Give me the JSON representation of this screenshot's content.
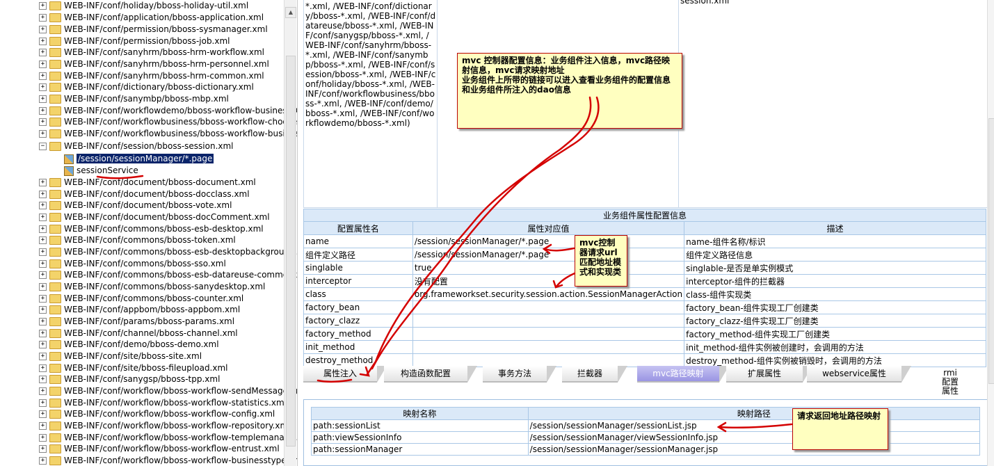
{
  "tree": {
    "items": [
      {
        "label": "WEB-INF/conf/holiday/bboss-holiday-util.xml",
        "type": "folder"
      },
      {
        "label": "WEB-INF/conf/application/bboss-application.xml",
        "type": "folder"
      },
      {
        "label": "WEB-INF/conf/permission/bboss-sysmanager.xml",
        "type": "folder"
      },
      {
        "label": "WEB-INF/conf/permission/bboss-job.xml",
        "type": "folder"
      },
      {
        "label": "WEB-INF/conf/sanyhrm/bboss-hrm-workflow.xml",
        "type": "folder"
      },
      {
        "label": "WEB-INF/conf/sanyhrm/bboss-hrm-personnel.xml",
        "type": "folder"
      },
      {
        "label": "WEB-INF/conf/sanyhrm/bboss-hrm-common.xml",
        "type": "folder"
      },
      {
        "label": "WEB-INF/conf/dictionary/bboss-dictionary.xml",
        "type": "folder"
      },
      {
        "label": "WEB-INF/conf/sanymbp/bboss-mbp.xml",
        "type": "folder"
      },
      {
        "label": "WEB-INF/conf/workflowdemo/bboss-workflow-businessDe",
        "type": "folder"
      },
      {
        "label": "WEB-INF/conf/workflowbusiness/bboss-workflow-chooseU",
        "type": "folder"
      },
      {
        "label": "WEB-INF/conf/workflowbusiness/bboss-workflow-business",
        "type": "folder"
      },
      {
        "label": "WEB-INF/conf/session/bboss-session.xml",
        "type": "folder-open"
      },
      {
        "label": "/session/sessionManager/*.page",
        "type": "leaf-selected"
      },
      {
        "label": "sessionService",
        "type": "leaf"
      },
      {
        "label": "WEB-INF/conf/document/bboss-document.xml",
        "type": "folder"
      },
      {
        "label": "WEB-INF/conf/document/bboss-docclass.xml",
        "type": "folder"
      },
      {
        "label": "WEB-INF/conf/document/bboss-vote.xml",
        "type": "folder"
      },
      {
        "label": "WEB-INF/conf/document/bboss-docComment.xml",
        "type": "folder"
      },
      {
        "label": "WEB-INF/conf/commons/bboss-esb-desktop.xml",
        "type": "folder"
      },
      {
        "label": "WEB-INF/conf/commons/bboss-token.xml",
        "type": "folder"
      },
      {
        "label": "WEB-INF/conf/commons/bboss-esb-desktopbackground.x",
        "type": "folder"
      },
      {
        "label": "WEB-INF/conf/commons/bboss-sso.xml",
        "type": "folder"
      },
      {
        "label": "WEB-INF/conf/commons/bboss-esb-datareuse-common.xr",
        "type": "folder"
      },
      {
        "label": "WEB-INF/conf/commons/bboss-sanydesktop.xml",
        "type": "folder"
      },
      {
        "label": "WEB-INF/conf/commons/bboss-counter.xml",
        "type": "folder"
      },
      {
        "label": "WEB-INF/conf/appbom/bboss-appbom.xml",
        "type": "folder"
      },
      {
        "label": "WEB-INF/conf/params/bboss-params.xml",
        "type": "folder"
      },
      {
        "label": "WEB-INF/conf/channel/bboss-channel.xml",
        "type": "folder"
      },
      {
        "label": "WEB-INF/conf/demo/bboss-demo.xml",
        "type": "folder"
      },
      {
        "label": "WEB-INF/conf/site/bboss-site.xml",
        "type": "folder"
      },
      {
        "label": "WEB-INF/conf/site/bboss-fileupload.xml",
        "type": "folder"
      },
      {
        "label": "WEB-INF/conf/sanygsp/bboss-tpp.xml",
        "type": "folder"
      },
      {
        "label": "WEB-INF/conf/workflow/bboss-workflow-sendMessage.xm",
        "type": "folder"
      },
      {
        "label": "WEB-INF/conf/workflow/bboss-workflow-statistics.xml",
        "type": "folder"
      },
      {
        "label": "WEB-INF/conf/workflow/bboss-workflow-config.xml",
        "type": "folder"
      },
      {
        "label": "WEB-INF/conf/workflow/bboss-workflow-repository.xml",
        "type": "folder"
      },
      {
        "label": "WEB-INF/conf/workflow/bboss-workflow-templemanage.x",
        "type": "folder"
      },
      {
        "label": "WEB-INF/conf/workflow/bboss-workflow-entrust.xml",
        "type": "folder"
      },
      {
        "label": "WEB-INF/conf/workflow/bboss-workflow-businesstype.xm",
        "type": "folder"
      }
    ]
  },
  "top_cells": {
    "paths_text": "*.xml, /WEB-INF/conf/dictionary/bboss-*.xml, /WEB-INF/conf/datareuse/bboss-*.xml, /WEB-INF/conf/sanygsp/bboss-*.xml, /WEB-INF/conf/sanyhrm/bboss-*.xml, /WEB-INF/conf/sanymbp/bboss-*.xml, /WEB-INF/conf/session/bboss-*.xml, /WEB-INF/conf/holiday/bboss-*.xml, /WEB-INF/conf/workflowbusiness/bboss-*.xml, /WEB-INF/conf/demo/bboss-*.xml, /WEB-INF/conf/workflowdemo/bboss-*.xml)",
    "right_text": "session.xml"
  },
  "props_table": {
    "caption": "业务组件属性配置信息",
    "headers": [
      "配置属性名",
      "属性对应值",
      "描述"
    ],
    "rows": [
      [
        "name",
        "/session/sessionManager/*.page",
        "name-组件名称/标识"
      ],
      [
        "组件定义路径",
        "/session/sessionManager/*.page",
        "组件定义路径信息"
      ],
      [
        "singlable",
        "true",
        "singlable-是否是单实例模式"
      ],
      [
        "interceptor",
        "没有配置",
        "interceptor-组件的拦截器"
      ],
      [
        "class",
        "org.frameworkset.security.session.action.SessionManagerAction",
        "class-组件实现类"
      ],
      [
        "factory_bean",
        "",
        "factory_bean-组件实现工厂创建类"
      ],
      [
        "factory_clazz",
        "",
        "factory_clazz-组件实现工厂创建类"
      ],
      [
        "factory_method",
        "",
        "factory_method-组件实现工厂创建类"
      ],
      [
        "init_method",
        "",
        "init_method-组件实例被创建时，会调用的方法"
      ],
      [
        "destroy_method",
        "",
        "destroy_method-组件实例被销毁时，会调用的方法"
      ]
    ]
  },
  "tabs": [
    {
      "label": "属性注入",
      "active": false
    },
    {
      "label": "构造函数配置",
      "active": false
    },
    {
      "label": "事务方法",
      "active": false
    },
    {
      "label": "拦截器",
      "active": false
    },
    {
      "label": "mvc路径映射",
      "active": true
    },
    {
      "label": "扩展属性",
      "active": false
    },
    {
      "label": "webservice属性",
      "active": false
    },
    {
      "label": "rmi 配置 属性",
      "active": false
    }
  ],
  "mapping_table": {
    "headers": [
      "映射名称",
      "映射路径"
    ],
    "rows": [
      [
        "path:sessionList",
        "/session/sessionManager/sessionList.jsp"
      ],
      [
        "path:viewSessionInfo",
        "/session/sessionManager/viewSessionInfo.jsp"
      ],
      [
        "path:sessionManager",
        "/session/sessionManager/sessionManager.jsp"
      ]
    ]
  },
  "callouts": {
    "main": "mvc 控制器配置信息：业务组件注入信息，mvc路径映射信息，mvc请求映射地址\n业务组件上所带的链接可以进入查看业务组件的配置信息和业务组件所注入的dao信息",
    "url": "mvc控制器请求url匹配地址模式和实现类",
    "return": "请求返回地址路径映射"
  },
  "colors": {
    "annotation_red": "#d40000",
    "callout_bg": "#ffffc0",
    "header_blue": "#dbe9f8",
    "selected_bg": "#0a246a",
    "active_tab": "#9a95e3"
  }
}
